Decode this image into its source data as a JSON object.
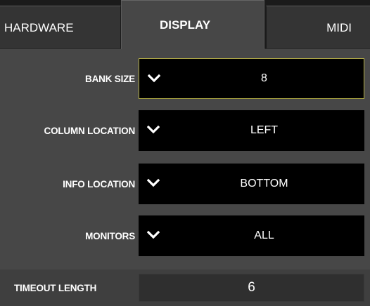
{
  "tabs": [
    {
      "label": "HARDWARE",
      "active": false
    },
    {
      "label": "DISPLAY",
      "active": true
    },
    {
      "label": "MIDI",
      "active": false
    }
  ],
  "settings": [
    {
      "label": "BANK SIZE",
      "value": "8",
      "icon": "chevron-down-icon",
      "focused": true
    },
    {
      "label": "COLUMN LOCATION",
      "value": "LEFT",
      "icon": "chevron-down-icon",
      "focused": false
    },
    {
      "label": "INFO LOCATION",
      "value": "BOTTOM",
      "icon": "chevron-down-icon",
      "focused": false
    },
    {
      "label": "MONITORS",
      "value": "ALL",
      "icon": "chevron-down-icon",
      "focused": false
    }
  ],
  "timeout": {
    "label": "TIMEOUT LENGTH",
    "value": "6"
  },
  "colors": {
    "focus_border": "#b7b146",
    "panel_bg": "#474747",
    "select_bg": "#000000",
    "text": "#ffffff"
  }
}
